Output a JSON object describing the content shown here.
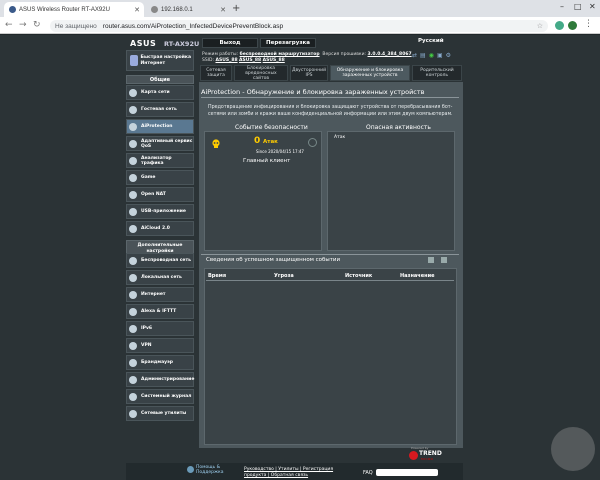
{
  "browser": {
    "tabs": [
      {
        "title": "ASUS Wireless Router RT-AX92U",
        "active": true
      },
      {
        "title": "192.168.0.1",
        "active": false
      }
    ],
    "insecure_label": "Не защищено",
    "url": "router.asus.com/AiProtection_InfectedDevicePreventBlock.asp"
  },
  "header": {
    "logo": "ASUS",
    "model": "RT-AX92U",
    "logout": "Выход",
    "reboot": "Перезагрузка",
    "language": "Русский",
    "mode_label": "Режим работы:",
    "mode_value": "беспроводной маршрутизатор",
    "firmware_label": "Версия прошивки:",
    "firmware_value": "3.0.0.4_384_8067",
    "ssid_label": "SSID:",
    "ssids": [
      "ASUS_88",
      "ASUS_88",
      "ASUS_88"
    ]
  },
  "sidebar": {
    "quick_setup": "Быстрая настройка Интернет",
    "general_header": "Общие",
    "general_items": [
      {
        "label": "Карта сети",
        "selected": false
      },
      {
        "label": "Гостевая сеть",
        "selected": false
      },
      {
        "label": "AiProtection",
        "selected": true
      },
      {
        "label": "Адаптивный сервис QoS",
        "selected": false
      },
      {
        "label": "Анализатор трафика",
        "selected": false
      },
      {
        "label": "Game",
        "selected": false
      },
      {
        "label": "Open NAT",
        "selected": false
      },
      {
        "label": "USB-приложение",
        "selected": false
      },
      {
        "label": "AiCloud 2.0",
        "selected": false
      }
    ],
    "advanced_header": "Дополнительные настройки",
    "advanced_items": [
      "Беспроводная сеть",
      "Локальная сеть",
      "Интернет",
      "Alexa & IFTTT",
      "IPv6",
      "VPN",
      "Брандмауэр",
      "Администрирование",
      "Системный журнал",
      "Сетевые утилиты"
    ]
  },
  "tabs": [
    {
      "label": "Сетевая защита",
      "active": false
    },
    {
      "label": "Блокировка вредоносных сайтов",
      "active": false
    },
    {
      "label": "Двусторонний IPS",
      "active": false
    },
    {
      "label": "Обнаружение и блокировка зараженных устройств",
      "active": true
    },
    {
      "label": "Родительский контроль",
      "active": false
    }
  ],
  "main": {
    "title": "AiProtection - Обнаружение и блокировка зараженных устройств",
    "description": "Предотвращение инфицирования и блокировка защищают устройства от перебрасывания бот-сетями или зомби и кражи ваше конфиденциальной информации или этим двум компьютерам.",
    "security_event_header": "Событие безопасности",
    "danger_header": "Опасная активность",
    "attack_count": "0",
    "attack_label": "Атак",
    "since_label": "Since 2020/04/15 17:47",
    "client_label": "Главный клиент",
    "attack_axis_label": "Атак",
    "events_title": "Сведения об успешном защищенном событии",
    "columns": [
      "Время",
      "Угроза",
      "Источник",
      "Назначение"
    ],
    "powered_by": "Powered by",
    "trend": "TREND",
    "trend_sub": "MICRO"
  },
  "footer": {
    "help": "Помощь & Поддержка",
    "links_line1": "Руководство | Утилиты | Регистрация",
    "links_line2": "продукта | Обратная связь",
    "faq": "FAQ"
  }
}
